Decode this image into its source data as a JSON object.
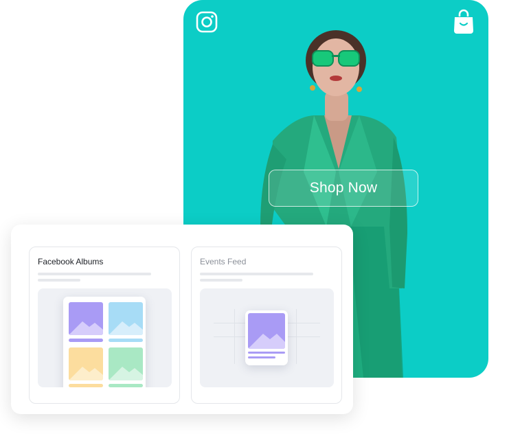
{
  "promo": {
    "cta_label": "Shop Now",
    "background": "#0ccdc6",
    "icons": {
      "top_left": "instagram-icon",
      "top_right": "shopping-bag-icon"
    }
  },
  "widgets": {
    "cards": [
      {
        "title": "Facebook Albums"
      },
      {
        "title": "Events Feed"
      }
    ],
    "tile_colors": [
      "#a99bf5",
      "#a7dcf6",
      "#fcdd9e",
      "#a9e8c4"
    ]
  }
}
